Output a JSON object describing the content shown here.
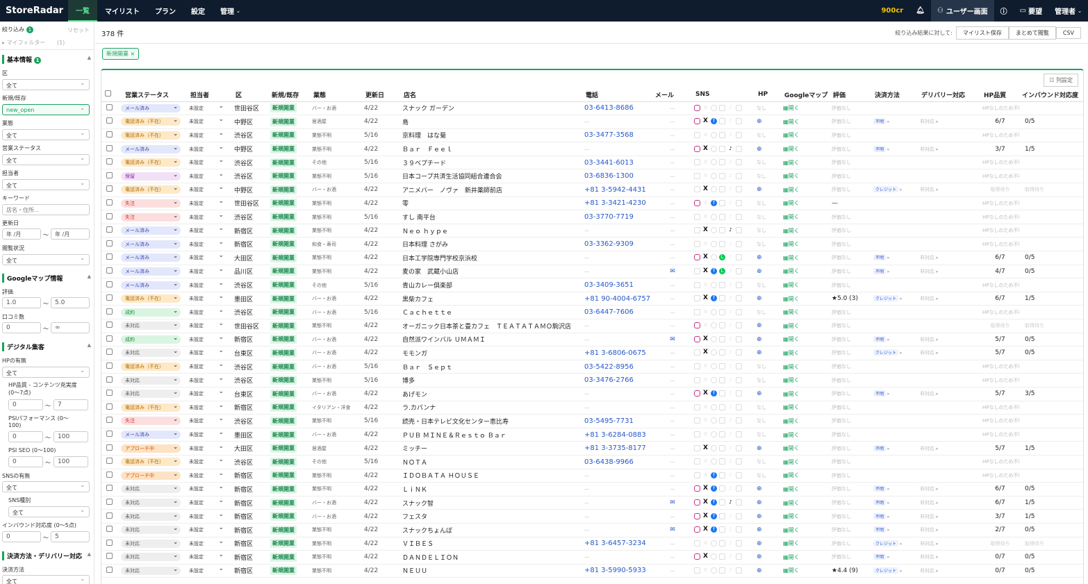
{
  "topbar": {
    "logo": "StoreRadar",
    "nav": [
      "一覧",
      "マイリスト",
      "プラン",
      "設定",
      "管理"
    ],
    "credits": "900cr",
    "user_view": "ユーザー画面",
    "request": "要望",
    "admin": "管理者"
  },
  "sidebar": {
    "filter_title": "絞り込み",
    "filter_count": "1",
    "reset": "リセット",
    "my_filter": "マイフィルター",
    "my_filter_count": "(1)",
    "basic": "基本情報",
    "basic_count": "1",
    "ward_label": "区",
    "ward_value": "全て",
    "newexist_label": "新規/既存",
    "newexist_value": "new_open",
    "biz_label": "業態",
    "biz_value": "全て",
    "status_label": "営業ステータス",
    "status_value": "全て",
    "owner_label": "担当者",
    "owner_value": "全て",
    "keyword_label": "キーワード",
    "keyword_placeholder": "店名・住所...",
    "updated_label": "更新日",
    "date_ph": "年 /月",
    "browse_label": "閲覧状況",
    "browse_value": "全て",
    "gmap": "Googleマップ情報",
    "rating_label": "評価",
    "rating_min": "1.0",
    "rating_max": "5.0",
    "review_label": "口コミ数",
    "review_min": "0",
    "review_max": "∞",
    "digital": "デジタル集客",
    "hp_label": "HPの有無",
    "hp_value": "全て",
    "hpq_label": "HP品質 - コンテンツ充実度 (0〜7点)",
    "hpq_min": "0",
    "hpq_max": "7",
    "psi_label": "PSIパフォーマンス (0〜100)",
    "psi_min": "0",
    "psi_max": "100",
    "seo_label": "PSI SEO (0〜100)",
    "seo_min": "0",
    "seo_max": "100",
    "sns_label": "SNSの有無",
    "sns_value": "全て",
    "snstype_label": "SNS種別",
    "snstype_value": "全て",
    "inbound_label": "インバウンド対応度 (0〜5点)",
    "inbound_min": "0",
    "inbound_max": "5",
    "payment": "決済方法・デリバリー対応",
    "pay_label": "決済方法",
    "pay_value": "全て"
  },
  "main": {
    "count": "378 件",
    "action_label": "絞り込み結果に対して:",
    "btn_mylist": "マイリスト保存",
    "btn_bulk": "まとめて閲覧",
    "btn_csv": "CSV",
    "chip": "新規開業 ×",
    "col_settings": "列設定"
  },
  "columns": [
    "営業ステータス",
    "担当者",
    "区",
    "新規/既存",
    "業態",
    "更新日",
    "店名",
    "電話",
    "メール",
    "SNS",
    "HP",
    "Googleマップ",
    "評価",
    "決済方法",
    "デリバリー対応",
    "HP品質",
    "インバウンド対応度"
  ],
  "labels": {
    "unassigned": "未設定",
    "newopen": "新規開業",
    "gmap_open": "開く",
    "no_rating": "評価なし",
    "nashi": "なし",
    "unknown": "不明",
    "nondeliv": "非対応",
    "nohp": "HPなしのため不明",
    "credit": "クレジット",
    "na": "取得待ち"
  },
  "colors": {
    "accent": "#1aa260",
    "topbar": "#0f1c2e"
  },
  "rows": [
    {
      "st": "メール済み",
      "w": "世田谷区",
      "b": "バー・お酒",
      "d": "4/22",
      "n": "スナック ガーデン",
      "p": "03-6413-8686",
      "sns": "i",
      "hp": 0,
      "r": "",
      "pay": "",
      "q": "",
      "ib": ""
    },
    {
      "st": "電話済み（不在）",
      "w": "中野区",
      "b": "居酒屋",
      "d": "4/22",
      "n": "島",
      "p": "",
      "sns": "ixf",
      "hp": 1,
      "r": "",
      "pay": "不明",
      "q": "6/7",
      "ib": "0/5"
    },
    {
      "st": "電話済み（不在）",
      "w": "渋谷区",
      "b": "業態不明",
      "d": "5/16",
      "n": "京料理　はな菊",
      "p": "03-3477-3568",
      "sns": "",
      "hp": 0,
      "r": "",
      "pay": "",
      "q": "",
      "ib": ""
    },
    {
      "st": "メール済み",
      "w": "中野区",
      "b": "業態不明",
      "d": "4/22",
      "n": "Ｂａｒ　Ｆｅｅｌ",
      "p": "",
      "sns": "ixt",
      "hp": 1,
      "r": "",
      "pay": "不明",
      "q": "3/7",
      "ib": "1/5"
    },
    {
      "st": "電話済み（不在）",
      "w": "渋谷区",
      "b": "その他",
      "d": "5/16",
      "n": "３９ベプチード",
      "p": "03-3441-6013",
      "sns": "",
      "hp": 0,
      "r": "",
      "pay": "",
      "q": "",
      "ib": ""
    },
    {
      "st": "保留",
      "w": "渋谷区",
      "b": "業態不明",
      "d": "5/16",
      "n": "日本コープ共済生活協同組合連合会",
      "p": "03-6836-1300",
      "sns": "",
      "hp": 0,
      "r": "",
      "pay": "",
      "q": "",
      "ib": ""
    },
    {
      "st": "電話済み（不在）",
      "w": "中野区",
      "b": "バー・お酒",
      "d": "4/22",
      "n": "アニメバー　ノヴァ　新井薬師前店",
      "p": "+81 3-5942-4431",
      "sns": "x",
      "hp": 1,
      "r": "",
      "pay": "クレジット",
      "q": "取得待ち",
      "ib": "取得待ち"
    },
    {
      "st": "失注",
      "w": "世田谷区",
      "b": "業態不明",
      "d": "4/22",
      "n": "零",
      "p": "+81 3-3421-4230",
      "sns": "if",
      "hp": 0,
      "r": "—",
      "pay": "",
      "q": "",
      "ib": ""
    },
    {
      "st": "失注",
      "w": "渋谷区",
      "b": "業態不明",
      "d": "5/16",
      "n": "すし 南平台",
      "p": "03-3770-7719",
      "sns": "",
      "hp": 0,
      "r": "",
      "pay": "",
      "q": "",
      "ib": ""
    },
    {
      "st": "メール済み",
      "w": "新宿区",
      "b": "業態不明",
      "d": "4/22",
      "n": "Ｎｅｏ ｈｙｐｅ",
      "p": "",
      "sns": "xt",
      "hp": 0,
      "r": "",
      "pay": "",
      "q": "",
      "ib": ""
    },
    {
      "st": "メール済み",
      "w": "新宿区",
      "b": "和食・寿司",
      "d": "4/22",
      "n": "日本料理 さがみ",
      "p": "03-3362-9309",
      "sns": "",
      "hp": 0,
      "r": "",
      "pay": "",
      "q": "",
      "ib": ""
    },
    {
      "st": "メール済み",
      "w": "大田区",
      "b": "業態不明",
      "d": "4/22",
      "n": "日本工学院専門学校京浜校",
      "p": "",
      "sns": "ixl",
      "hp": 1,
      "r": "",
      "pay": "不明",
      "q": "6/7",
      "ib": "0/5"
    },
    {
      "st": "メール済み",
      "w": "品川区",
      "b": "業態不明",
      "d": "4/22",
      "n": "麦の家　武蔵小山店",
      "p": "",
      "m": 1,
      "sns": "xfl",
      "hp": 1,
      "r": "",
      "pay": "不明",
      "q": "4/7",
      "ib": "0/5"
    },
    {
      "st": "メール済み",
      "w": "渋谷区",
      "b": "その他",
      "d": "5/16",
      "n": "青山カレー倶楽部",
      "p": "03-3409-3651",
      "sns": "",
      "hp": 0,
      "r": "",
      "pay": "",
      "q": "",
      "ib": ""
    },
    {
      "st": "電話済み（不在）",
      "w": "墨田区",
      "b": "バー・お酒",
      "d": "4/22",
      "n": "黒柴カフェ",
      "p": "+81 90-4004-6757",
      "sns": "xf",
      "hp": 1,
      "r": "★5.0 (3)",
      "pay": "クレジット",
      "q": "6/7",
      "ib": "1/5"
    },
    {
      "st": "成約",
      "w": "渋谷区",
      "b": "バー・お酒",
      "d": "5/16",
      "n": "Ｃａｃｈｅｔｔｅ",
      "p": "03-6447-7606",
      "sns": "",
      "hp": 0,
      "r": "",
      "pay": "",
      "q": "",
      "ib": ""
    },
    {
      "st": "未対応",
      "w": "世田谷区",
      "b": "業態不明",
      "d": "4/22",
      "n": "オーガニック日本茶と畳カフェ　ＴＥＡＴＡＴＡＭＯ駒沢店",
      "p": "",
      "sns": "i",
      "hp": 1,
      "r": "",
      "pay": "",
      "q": "取得待ち",
      "ib": "取得待ち"
    },
    {
      "st": "成約",
      "w": "新宿区",
      "b": "バー・お酒",
      "d": "4/22",
      "n": "自然派ワインバル ＵＭＡＭＩ",
      "p": "",
      "m": 1,
      "sns": "ix",
      "hp": 1,
      "r": "",
      "pay": "不明",
      "q": "5/7",
      "ib": "0/5"
    },
    {
      "st": "未対応",
      "w": "台東区",
      "b": "バー・お酒",
      "d": "4/22",
      "n": "モモンガ",
      "p": "+81 3-6806-0675",
      "sns": "x",
      "hp": 1,
      "r": "",
      "pay": "クレジット",
      "q": "5/7",
      "ib": "0/5"
    },
    {
      "st": "電話済み（不在）",
      "w": "渋谷区",
      "b": "バー・お酒",
      "d": "5/16",
      "n": "Ｂａｒ　Ｓｅｐｔ",
      "p": "03-5422-8956",
      "sns": "",
      "hp": 0,
      "r": "",
      "pay": "",
      "q": "",
      "ib": ""
    },
    {
      "st": "未対応",
      "w": "渋谷区",
      "b": "業態不明",
      "d": "5/16",
      "n": "博多",
      "p": "03-3476-2766",
      "sns": "",
      "hp": 0,
      "r": "",
      "pay": "",
      "q": "",
      "ib": ""
    },
    {
      "st": "未対応",
      "w": "台東区",
      "b": "バー・お酒",
      "d": "4/22",
      "n": "あげモン",
      "p": "",
      "sns": "ixf",
      "hp": 1,
      "r": "",
      "pay": "不明",
      "q": "5/7",
      "ib": "3/5"
    },
    {
      "st": "電話済み（不在）",
      "w": "新宿区",
      "b": "イタリアン・洋食",
      "d": "4/22",
      "n": "ラ.カパンナ",
      "p": "",
      "sns": "",
      "hp": 0,
      "r": "",
      "pay": "",
      "q": "",
      "ib": ""
    },
    {
      "st": "失注",
      "w": "渋谷区",
      "b": "業態不明",
      "d": "5/16",
      "n": "読売・日本テレビ文化センター恵比寿",
      "p": "03-5495-7731",
      "sns": "",
      "hp": 0,
      "r": "",
      "pay": "",
      "q": "",
      "ib": ""
    },
    {
      "st": "メール済み",
      "w": "墨田区",
      "b": "バー・お酒",
      "d": "4/22",
      "n": "ＰＵＢ ＭＩＮＥ＆Ｒｅｓｔｏ Ｂａｒ",
      "p": "+81 3-6284-0883",
      "sns": "",
      "hp": 0,
      "r": "",
      "pay": "",
      "q": "",
      "ib": ""
    },
    {
      "st": "アプローチ中",
      "w": "大田区",
      "b": "居酒屋",
      "d": "4/22",
      "n": "ミッチー",
      "p": "+81 3-3735-8177",
      "sns": "x",
      "hp": 1,
      "r": "",
      "pay": "不明",
      "q": "5/7",
      "ib": "1/5"
    },
    {
      "st": "電話済み（不在）",
      "w": "渋谷区",
      "b": "その他",
      "d": "5/16",
      "n": "ＮＯＴＡ",
      "p": "03-6438-9966",
      "sns": "",
      "hp": 0,
      "r": "",
      "pay": "",
      "q": "",
      "ib": ""
    },
    {
      "st": "アプローチ中",
      "w": "新宿区",
      "b": "業態不明",
      "d": "4/22",
      "n": "ＩＤＯＢＡＴＡ ＨＯＵＳＥ",
      "p": "",
      "sns": "f",
      "hp": 0,
      "r": "",
      "pay": "",
      "q": "",
      "ib": ""
    },
    {
      "st": "未対応",
      "w": "新宿区",
      "b": "業態不明",
      "d": "4/22",
      "n": "ＬｉＮＫ",
      "p": "",
      "sns": "ixf",
      "hp": 1,
      "r": "",
      "pay": "不明",
      "q": "6/7",
      "ib": "0/5"
    },
    {
      "st": "未対応",
      "w": "新宿区",
      "b": "バー・お酒",
      "d": "4/22",
      "n": "スナック智",
      "p": "",
      "m": 1,
      "sns": "ixft",
      "hp": 1,
      "r": "",
      "pay": "不明",
      "q": "6/7",
      "ib": "1/5"
    },
    {
      "st": "未対応",
      "w": "新宿区",
      "b": "バー・お酒",
      "d": "4/22",
      "n": "フェスタ",
      "p": "",
      "sns": "ixf",
      "hp": 1,
      "r": "",
      "pay": "不明",
      "q": "3/7",
      "ib": "1/5"
    },
    {
      "st": "未対応",
      "w": "新宿区",
      "b": "業態不明",
      "d": "4/22",
      "n": "スナックちょんぼ",
      "p": "",
      "m": 1,
      "sns": "ixf",
      "hp": 1,
      "r": "",
      "pay": "不明",
      "q": "2/7",
      "ib": "0/5"
    },
    {
      "st": "未対応",
      "w": "新宿区",
      "b": "業態不明",
      "d": "4/22",
      "n": "ＶＩＢＥＳ",
      "p": "+81 3-6457-3234",
      "sns": "",
      "hp": 1,
      "r": "",
      "pay": "クレジット",
      "q": "取得待ち",
      "ib": "取得待ち"
    },
    {
      "st": "未対応",
      "w": "新宿区",
      "b": "業態不明",
      "d": "4/22",
      "n": "ＤＡＮＤＥＬＩＯＮ",
      "p": "",
      "sns": "ix",
      "hp": 1,
      "r": "",
      "pay": "不明",
      "q": "0/7",
      "ib": "0/5"
    },
    {
      "st": "未対応",
      "w": "新宿区",
      "b": "業態不明",
      "d": "4/22",
      "n": "ＮＥＵＵ",
      "p": "+81 3-5990-5933",
      "sns": "",
      "hp": 1,
      "r": "★4.4 (9)",
      "pay": "クレジット",
      "q": "0/7",
      "ib": "0/5"
    }
  ]
}
